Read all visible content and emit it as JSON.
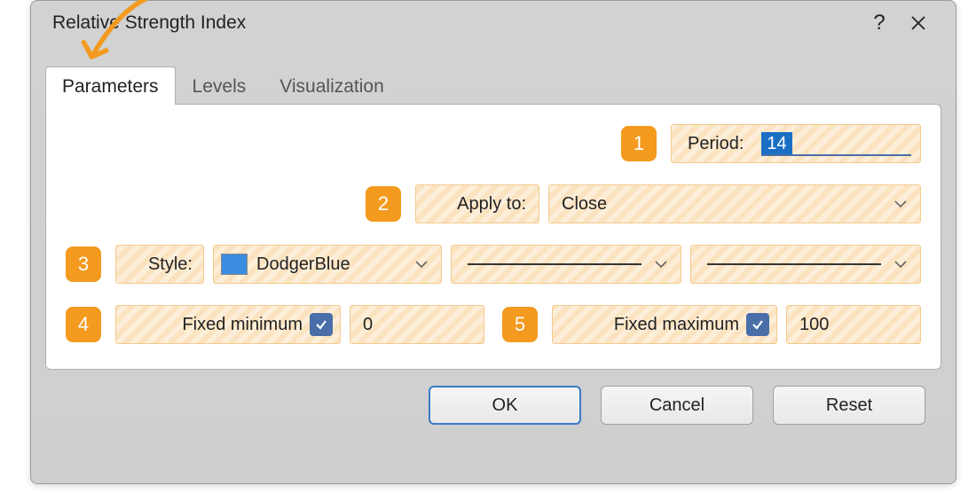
{
  "dialog": {
    "title": "Relative Strength Index"
  },
  "tabs": {
    "parameters": "Parameters",
    "levels": "Levels",
    "visualization": "Visualization"
  },
  "badges": {
    "b1": "1",
    "b2": "2",
    "b3": "3",
    "b4": "4",
    "b5": "5"
  },
  "period": {
    "label": "Period:",
    "value": "14"
  },
  "apply": {
    "label": "Apply to:",
    "value": "Close"
  },
  "style": {
    "label": "Style:",
    "color_name": "DodgerBlue",
    "color_hex": "#3a8de0"
  },
  "fixed_min": {
    "label": "Fixed minimum",
    "value": "0",
    "checked": true
  },
  "fixed_max": {
    "label": "Fixed maximum",
    "value": "100",
    "checked": true
  },
  "buttons": {
    "ok": "OK",
    "cancel": "Cancel",
    "reset": "Reset"
  },
  "titlebar": {
    "help": "?"
  }
}
